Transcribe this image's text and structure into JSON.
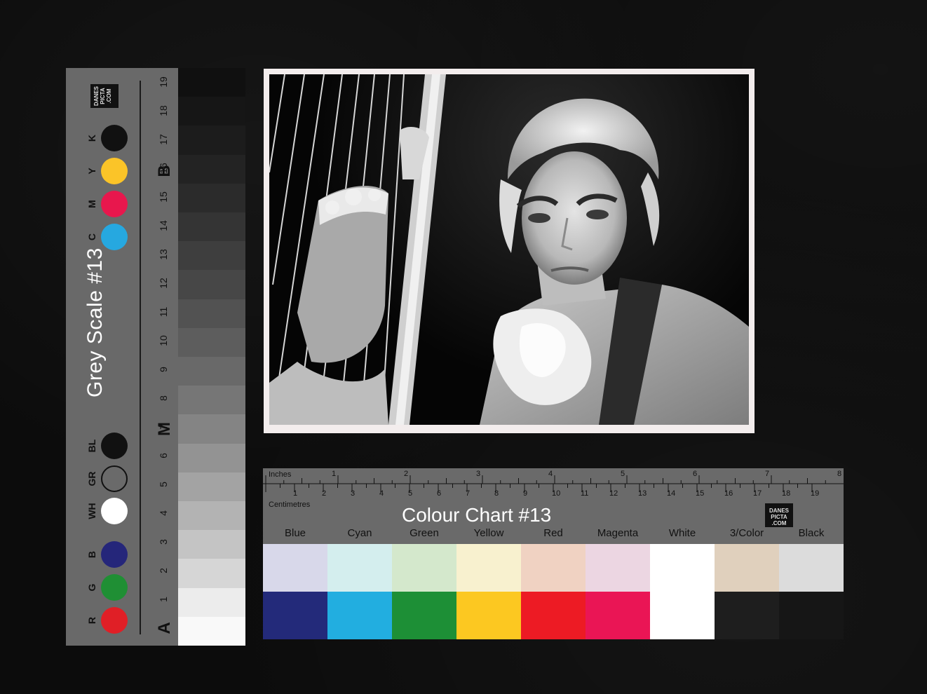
{
  "grey_scale": {
    "title": "Grey Scale #13",
    "end_label_a": "A",
    "mid_label_m": "M",
    "end_label_b": "B",
    "step_numbers": [
      "1",
      "2",
      "3",
      "4",
      "5",
      "6",
      "7",
      "8",
      "9",
      "10",
      "11",
      "12",
      "13",
      "14",
      "15",
      "16",
      "17",
      "18",
      "19"
    ],
    "steps": [
      "#f9f9f9",
      "#ececec",
      "#d6d6d6",
      "#c4c4c4",
      "#b3b3b3",
      "#a3a3a3",
      "#939393",
      "#848484",
      "#767676",
      "#696969",
      "#5d5d5d",
      "#525252",
      "#474747",
      "#3e3e3e",
      "#343434",
      "#2b2b2b",
      "#232323",
      "#1c1c1c",
      "#161616",
      "#101010"
    ],
    "swatches": [
      {
        "letter": "R",
        "color": "#e01f26"
      },
      {
        "letter": "G",
        "color": "#1f8f34"
      },
      {
        "letter": "B",
        "color": "#25267a"
      },
      {
        "letter": "WH",
        "color": "#ffffff"
      },
      {
        "letter": "GR",
        "color": "#6a6a6a"
      },
      {
        "letter": "BL",
        "color": "#111111"
      },
      {
        "letter": "C",
        "color": "#26a8e0"
      },
      {
        "letter": "M",
        "color": "#e8174d"
      },
      {
        "letter": "Y",
        "color": "#fbc428"
      },
      {
        "letter": "K",
        "color": "#111111"
      }
    ],
    "logo": "DANES PICTA .COM"
  },
  "photo": {
    "subject": "portrait"
  },
  "colour_chart": {
    "title": "Colour Chart #13",
    "inches_label": "Inches",
    "centimetres_label": "Centimetres",
    "inch_numbers": [
      "1",
      "2",
      "3",
      "4",
      "5",
      "6",
      "7",
      "8"
    ],
    "cm_numbers": [
      "1",
      "2",
      "3",
      "4",
      "5",
      "6",
      "7",
      "8",
      "9",
      "10",
      "11",
      "12",
      "13",
      "14",
      "15",
      "16",
      "17",
      "18",
      "19"
    ],
    "logo": "DANES PICTA .COM",
    "columns": [
      {
        "label": "Blue",
        "light": "#d8d8ea",
        "dark": "#232a7a"
      },
      {
        "label": "Cyan",
        "light": "#d4eeee",
        "dark": "#22aee0"
      },
      {
        "label": "Green",
        "light": "#d4e8cc",
        "dark": "#1d8f36"
      },
      {
        "label": "Yellow",
        "light": "#f8f1cf",
        "dark": "#fcc821"
      },
      {
        "label": "Red",
        "light": "#f0d2c2",
        "dark": "#ed1b24"
      },
      {
        "label": "Magenta",
        "light": "#ecd6e2",
        "dark": "#ea1555"
      },
      {
        "label": "White",
        "light": "#ffffff",
        "dark": "#ffffff"
      },
      {
        "label": "3/Color",
        "light": "#e0d0bd",
        "dark": "#1e1e1e"
      },
      {
        "label": "Black",
        "light": "#dcdcdc",
        "dark": "#161616"
      }
    ]
  }
}
